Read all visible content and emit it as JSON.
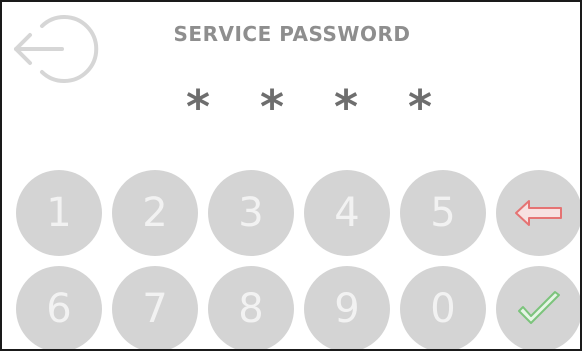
{
  "screen": {
    "title": "SERVICE PASSWORD",
    "password_mask": [
      "*",
      "*",
      "*",
      "*"
    ],
    "back_icon": "logout-back-icon"
  },
  "keypad": {
    "row1": [
      "1",
      "2",
      "3",
      "4",
      "5"
    ],
    "row2": [
      "6",
      "7",
      "8",
      "9",
      "0"
    ],
    "backspace_icon": "left-arrow-backspace-icon",
    "confirm_icon": "checkmark-icon"
  },
  "colors": {
    "key_background": "#d4d4d4",
    "key_digit": "#f2f2f2",
    "title": "#8e8e8e",
    "mask": "#6e6e6e",
    "backspace_accent": "#e57373",
    "confirm_accent": "#7cc47c",
    "border": "#1a1a1a"
  }
}
